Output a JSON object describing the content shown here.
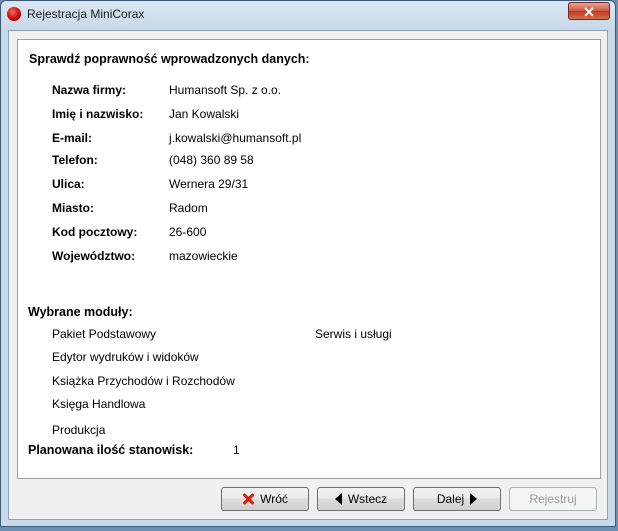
{
  "window": {
    "title": "Rejestracja MiniCorax",
    "close_label": "✕"
  },
  "summary": {
    "heading": "Sprawdź poprawność wprowadzonych danych:",
    "fields": [
      {
        "label": "Nazwa firmy:",
        "value": "Humansoft Sp. z o.o."
      },
      {
        "label": "Imię i nazwisko:",
        "value": "Jan Kowalski"
      },
      {
        "label": "E-mail:",
        "value": "j.kowalski@humansoft.pl"
      },
      {
        "label": "Telefon:",
        "value": "(048) 360 89 58"
      },
      {
        "label": "Ulica:",
        "value": "Wernera 29/31"
      },
      {
        "label": "Miasto:",
        "value": "Radom"
      },
      {
        "label": "Kod pocztowy:",
        "value": "26-600"
      },
      {
        "label": "Województwo:",
        "value": "mazowieckie"
      }
    ]
  },
  "modules": {
    "heading": "Wybrane moduły:",
    "items": [
      "Pakiet Podstawowy",
      "Serwis i usługi",
      "Edytor wydruków i widoków",
      "Książka Przychodów i Rozchodów",
      "Księga Handlowa",
      "Produkcja"
    ]
  },
  "stations": {
    "label": "Planowana ilość stanowisk:",
    "value": "1"
  },
  "buttons": {
    "close": "Wróć",
    "back": "Wstecz",
    "next": "Dalej",
    "register": "Rejestruj"
  }
}
